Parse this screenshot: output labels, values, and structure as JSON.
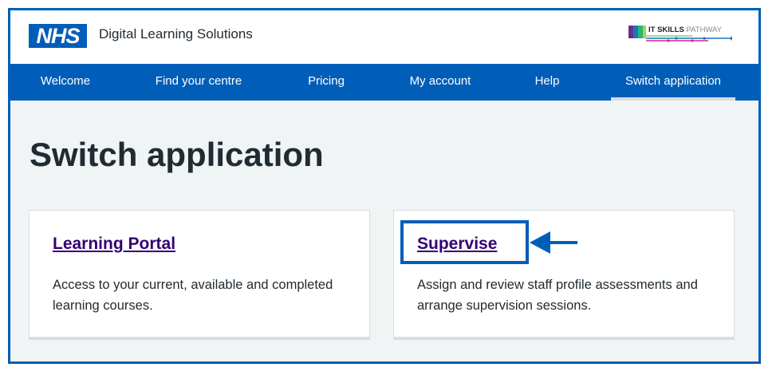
{
  "header": {
    "logo_text": "NHS",
    "app_title": "Digital Learning Solutions",
    "partner_logo": {
      "bold": "IT SKILLS",
      "light": "PATHWAY"
    }
  },
  "nav": {
    "items": [
      {
        "label": "Welcome"
      },
      {
        "label": "Find your centre"
      },
      {
        "label": "Pricing"
      },
      {
        "label": "My account"
      },
      {
        "label": "Help"
      },
      {
        "label": "Switch application",
        "active": true
      }
    ]
  },
  "main": {
    "title": "Switch application",
    "cards": [
      {
        "title": "Learning Portal",
        "description": "Access to your current, available and completed learning courses."
      },
      {
        "title": "Supervise",
        "description": "Assign and review staff profile assessments and arrange supervision sessions."
      }
    ]
  },
  "colors": {
    "brand_blue": "#005eb8",
    "link_purple": "#330072",
    "background": "#f0f4f5"
  }
}
